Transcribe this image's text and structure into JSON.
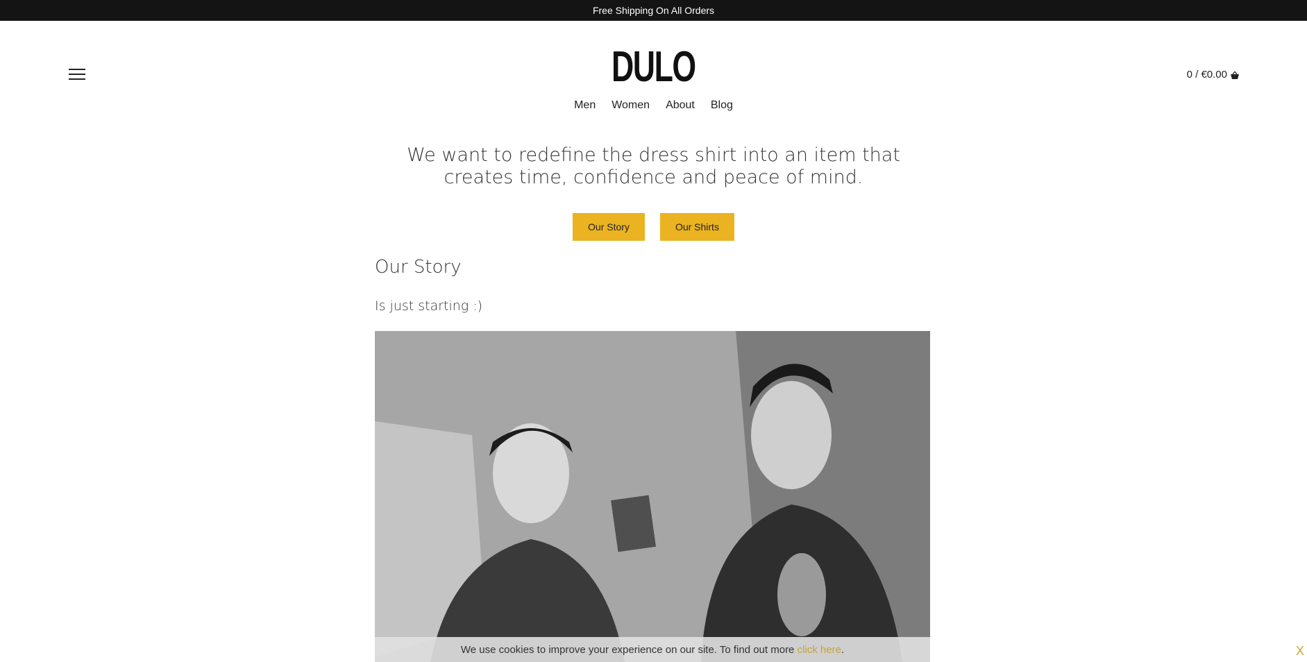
{
  "announcement": {
    "text": "Free Shipping On All Orders"
  },
  "header": {
    "logo": "DULO",
    "cart": {
      "text": "0 / €0.00"
    }
  },
  "nav": {
    "items": [
      {
        "label": "Men"
      },
      {
        "label": "Women"
      },
      {
        "label": "About"
      },
      {
        "label": "Blog"
      }
    ]
  },
  "hero": {
    "tagline_line1": "We want to redefine the dress shirt into an item that",
    "tagline_line2": "creates time, confidence and peace of mind.",
    "buttons": [
      {
        "label": "Our Story"
      },
      {
        "label": "Our Shirts"
      }
    ]
  },
  "story": {
    "title": "Our Story",
    "text": "Is just starting :)"
  },
  "cookie": {
    "text": "We use cookies to improve your experience on our site. To find out more",
    "link": "click here",
    "after": ".",
    "close": "X"
  },
  "colors": {
    "accent": "#ebb321",
    "announcement_bg": "#141414",
    "link": "#c9a434"
  }
}
